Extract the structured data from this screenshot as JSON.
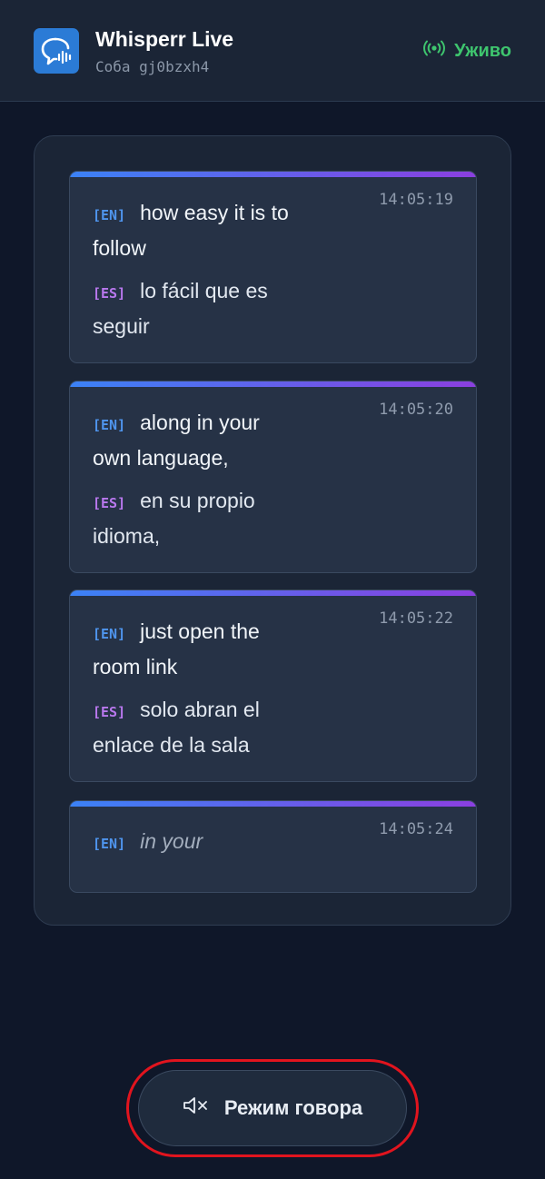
{
  "header": {
    "app_title": "Whisperr Live",
    "room_line": "Соба gj0bzxh4",
    "status_label": "Уживо",
    "status_icon": "broadcast-icon",
    "logo_icon": "chat-waveform-icon"
  },
  "colors": {
    "accent_blue": "#3b82f6",
    "accent_purple": "#8b3fe0",
    "live_green": "#3ec56e",
    "ring_red": "#e1141e"
  },
  "transcript": [
    {
      "time": "14:05:19",
      "en_tag": "[EN]",
      "en_l1": "how easy it is to",
      "en_l2": "follow",
      "es_tag": "[ES]",
      "es_l1": "lo fácil que es",
      "es_l2": "seguir"
    },
    {
      "time": "14:05:20",
      "en_tag": "[EN]",
      "en_l1": "along in your",
      "en_l2": "own language,",
      "es_tag": "[ES]",
      "es_l1": "en su propio",
      "es_l2": "idioma,"
    },
    {
      "time": "14:05:22",
      "en_tag": "[EN]",
      "en_l1": "just open the",
      "en_l2": "room link",
      "es_tag": "[ES]",
      "es_l1": "solo abran el",
      "es_l2": "enlace de la sala"
    },
    {
      "time": "14:05:24",
      "en_tag": "[EN]",
      "en_l1": "in your"
    }
  ],
  "speak_button": {
    "label": "Режим говора",
    "icon": "speaker-muted-icon"
  }
}
